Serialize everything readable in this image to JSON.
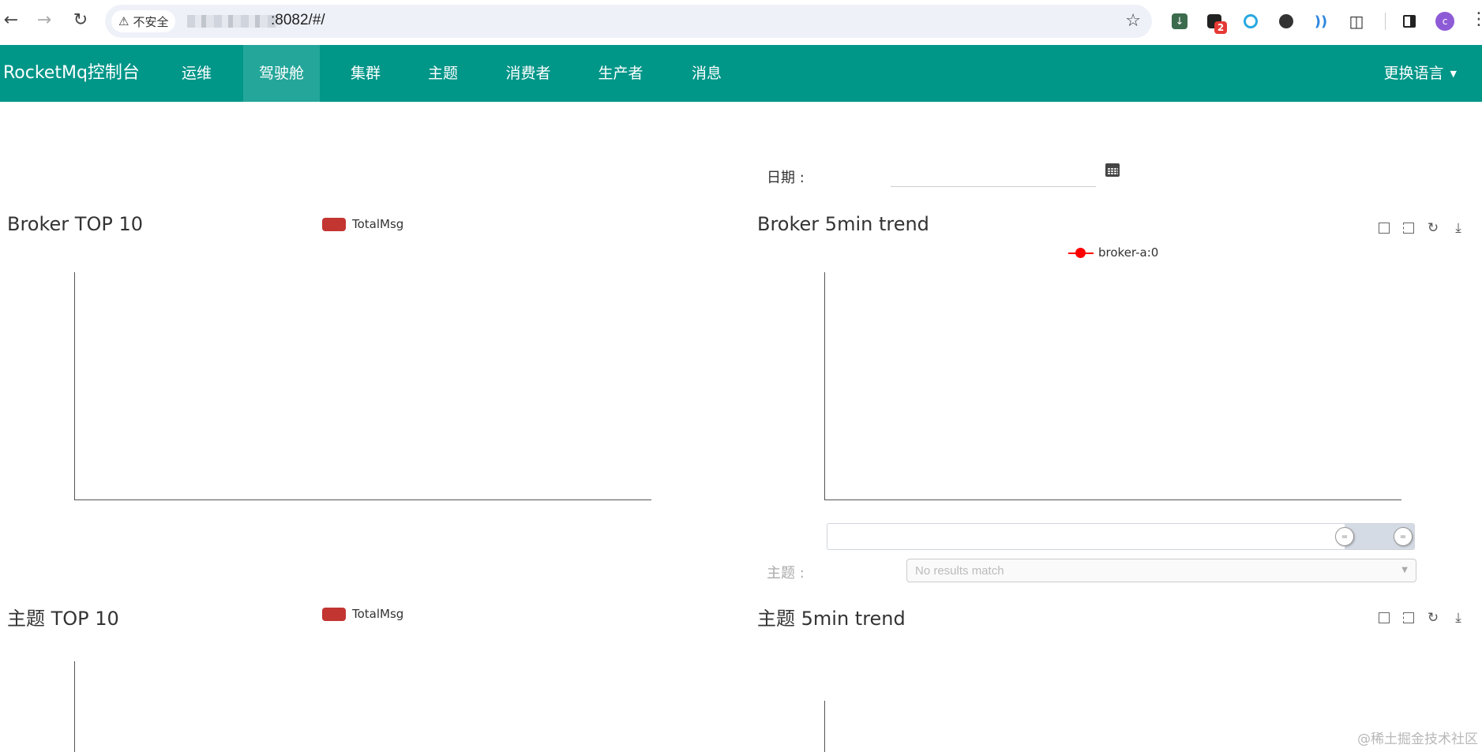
{
  "browser": {
    "security_label": "不安全",
    "url_suffix": ":8082/#/",
    "notification_badge": "2",
    "avatar_letter": "c"
  },
  "navbar": {
    "brand": "RocketMq控制台",
    "items": [
      "运维",
      "驾驶舱",
      "集群",
      "主题",
      "消费者",
      "生产者",
      "消息"
    ],
    "active_item": "驾驶舱",
    "language_label": "更换语言",
    "color": "#009688"
  },
  "filters": {
    "date_label": "日期 :",
    "date_value": "",
    "topic_label": "主题 :",
    "topic_placeholder": "No results match"
  },
  "panels": {
    "broker_top": {
      "title": "Broker TOP 10",
      "legend": "TotalMsg"
    },
    "broker_trend": {
      "title": "Broker 5min trend",
      "legend": "broker-a:0"
    },
    "topic_top": {
      "title": "主题 TOP 10",
      "legend": "TotalMsg"
    },
    "topic_trend": {
      "title": "主题 5min trend"
    }
  },
  "chart_data": [
    {
      "type": "bar",
      "title": "Broker TOP 10",
      "series": [
        {
          "name": "TotalMsg",
          "values": []
        }
      ],
      "categories": [],
      "legend_color": "#c23531"
    },
    {
      "type": "line",
      "title": "Broker 5min trend",
      "series": [
        {
          "name": "broker-a:0",
          "values": []
        }
      ],
      "x": [],
      "legend_color": "#ff0000",
      "datazoom_range": [
        0.89,
        1.0
      ]
    },
    {
      "type": "bar",
      "title": "主题 TOP 10",
      "series": [
        {
          "name": "TotalMsg",
          "values": []
        }
      ],
      "categories": [],
      "legend_color": "#c23531"
    },
    {
      "type": "line",
      "title": "主题 5min trend",
      "series": [],
      "x": []
    }
  ],
  "watermark": "@稀土掘金技术社区"
}
